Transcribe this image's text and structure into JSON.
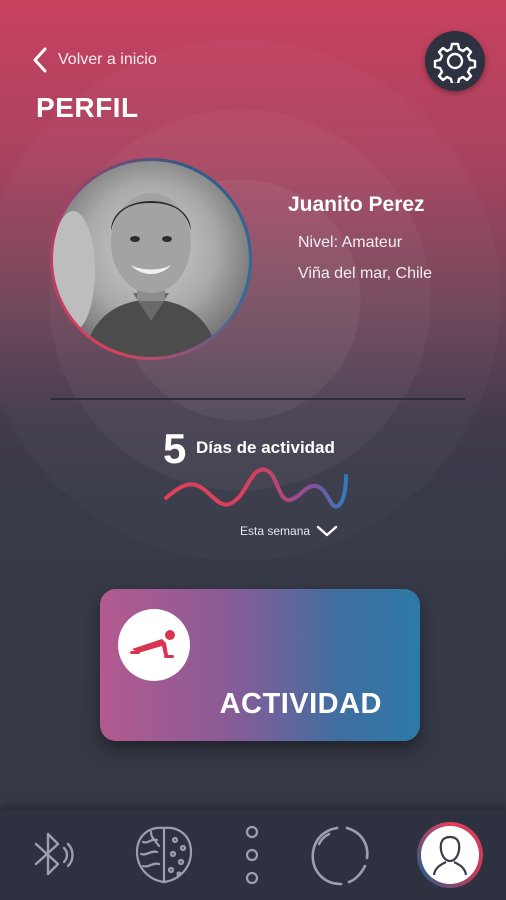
{
  "header": {
    "back_label": "Volver a inicio",
    "title": "PERFIL"
  },
  "profile": {
    "name": "Juanito Perez",
    "level": "Nivel: Amateur",
    "location": "Viña del mar, Chile"
  },
  "activity_summary": {
    "days_count": "5",
    "days_label": "Días de actividad",
    "period_label": "Esta semana"
  },
  "activity_card": {
    "label": "ACTIVIDAD"
  },
  "icons": {
    "back": "chevron-left-icon",
    "settings": "gear-icon",
    "expand": "chevron-down-icon",
    "activity": "pushup-icon",
    "nav": [
      "bluetooth-icon",
      "brain-icon",
      "more-vertical-icon",
      "progress-ring-icon",
      "user-icon"
    ]
  },
  "colors": {
    "accent_red": "#e0405c",
    "accent_blue": "#2f7bc0",
    "nav_background": "#2e3240"
  }
}
